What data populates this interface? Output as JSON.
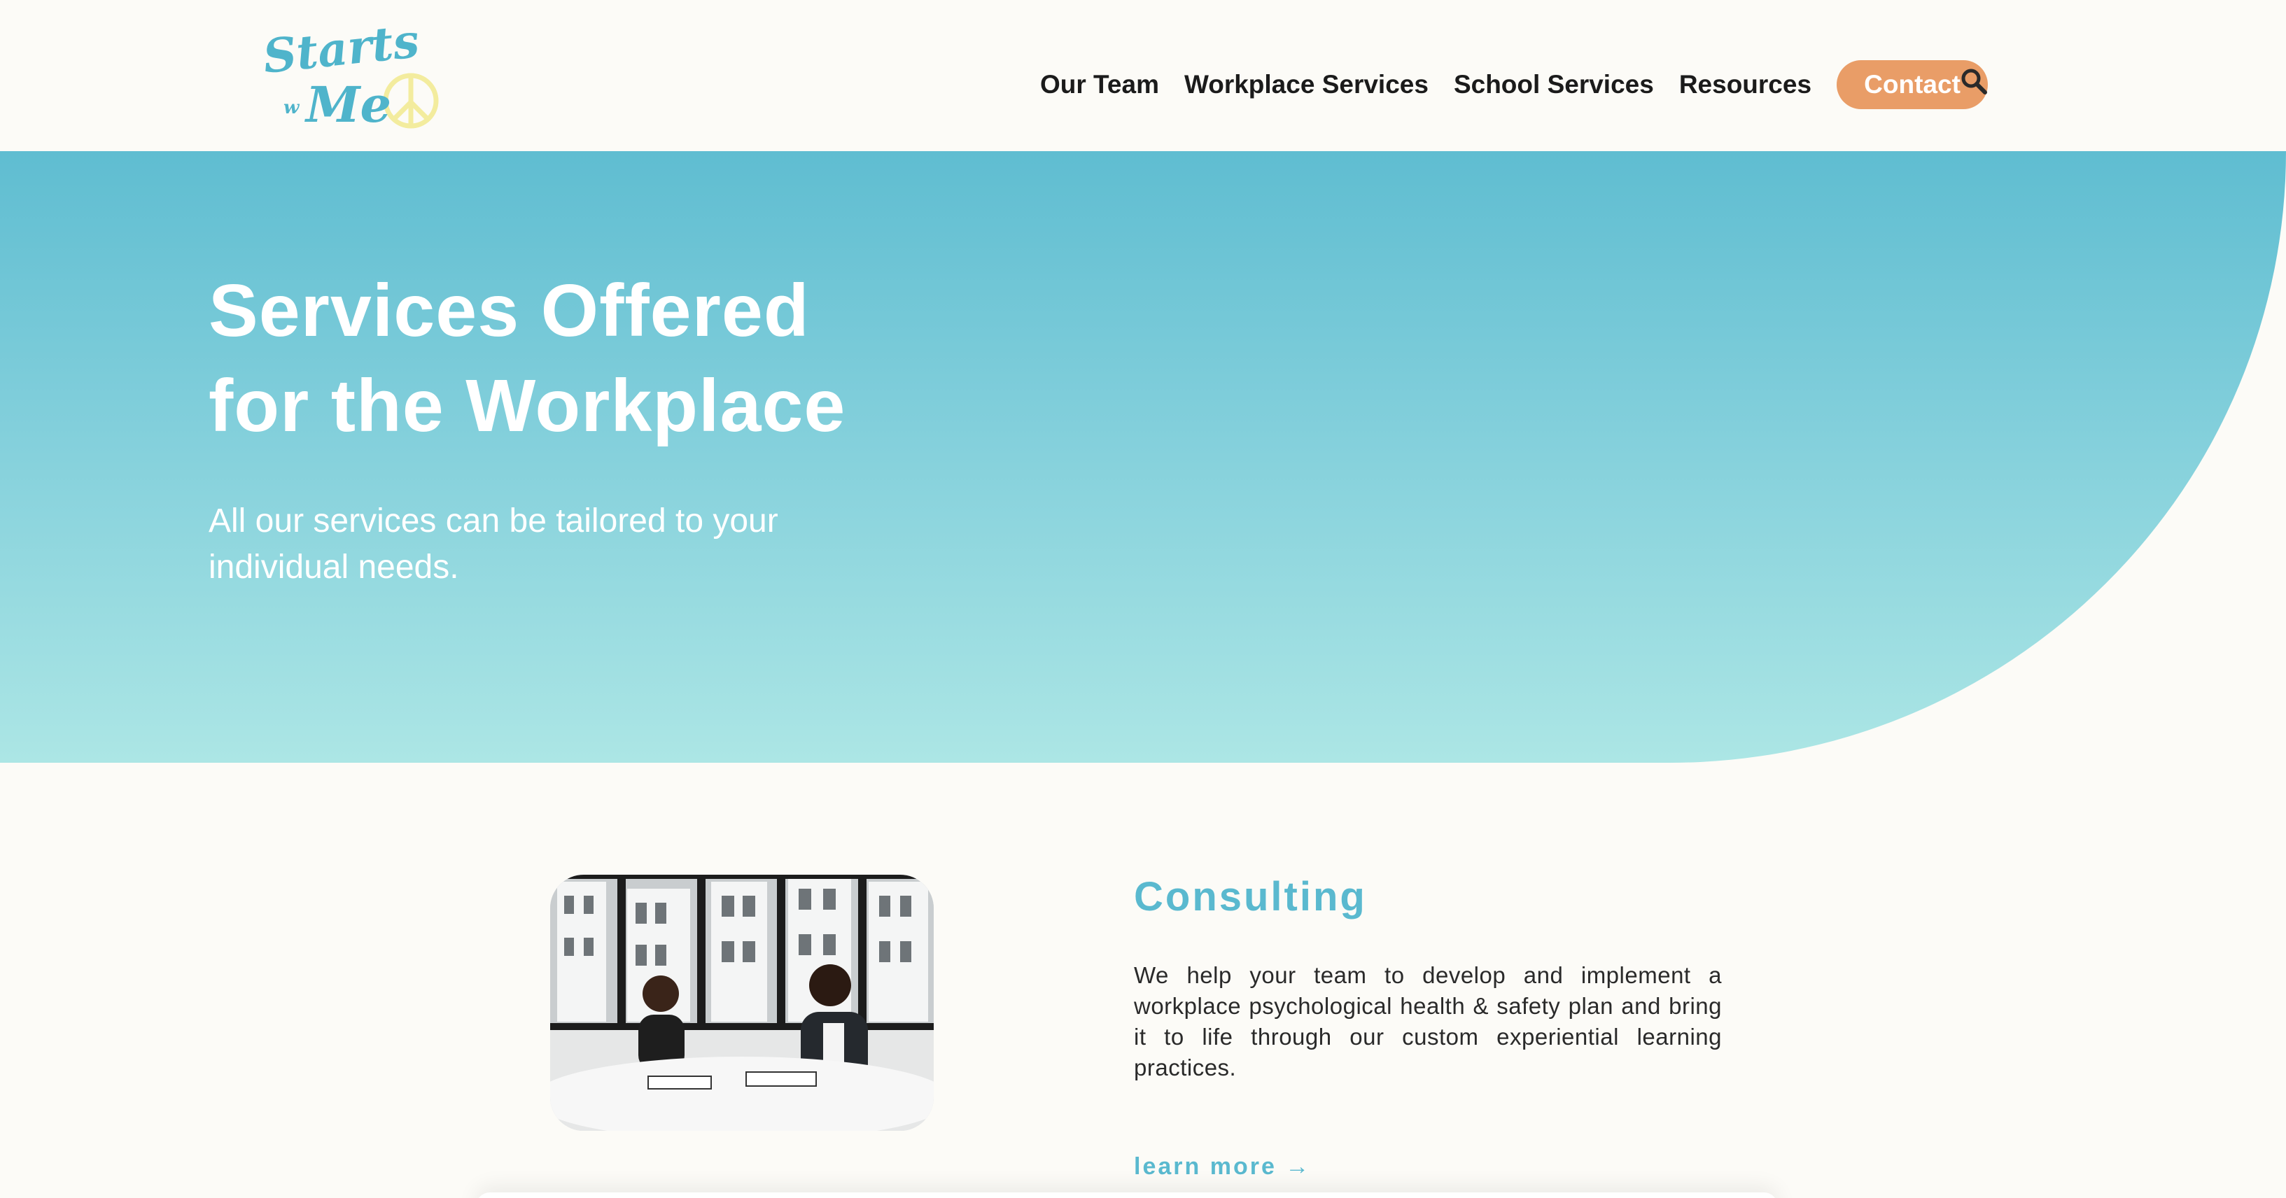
{
  "header": {
    "logo_text": [
      "Starts",
      "w",
      "Me"
    ],
    "nav": [
      {
        "label": "Our Team"
      },
      {
        "label": "Workplace Services"
      },
      {
        "label": "School Services"
      },
      {
        "label": "Resources"
      }
    ],
    "contact_label": "Contact",
    "search_icon": "search-icon"
  },
  "hero": {
    "title_line1": "Services Offered",
    "title_line2": "for the Workplace",
    "subtitle": "All our services can be tailored to your individual needs."
  },
  "consulting": {
    "title": "Consulting",
    "body": "We help your team to develop and implement a workplace psychological health & safety plan and bring it to life through our custom experiential learning practices.",
    "link_label": "learn more →"
  },
  "colors": {
    "accent_teal": "#5ab9cf",
    "contact_orange": "#e99d67",
    "logo_yellow": "#f3ec9e",
    "hero_gradient_top": "#5fbdd1",
    "hero_gradient_bottom": "#ace6e5",
    "background": "#fcfbf7"
  }
}
